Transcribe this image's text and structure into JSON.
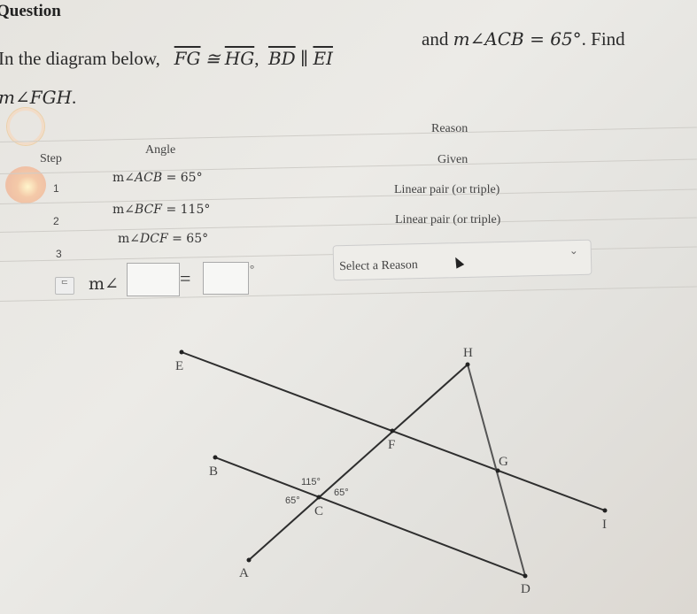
{
  "question_label": "Question",
  "prompt": {
    "intro": "In the diagram below,",
    "seg1": "FG",
    "congruent": "≅",
    "seg2": "HG",
    "comma": ",",
    "seg3": "BD",
    "parallel": "∥",
    "seg4": "EI",
    "and": "and",
    "given_angle": "m∠ACB = 65°",
    "find": ". Find",
    "target": "m∠FGH",
    "period": "."
  },
  "table": {
    "headers": {
      "step": "Step",
      "angle": "Angle",
      "reason": "Reason"
    },
    "rows": [
      {
        "step": "1",
        "angle_m": "m∠",
        "angle_name": "ACB",
        "angle_value": "= 65°",
        "reason": "Given"
      },
      {
        "step": "2",
        "angle_m": "m∠",
        "angle_name": "BCF",
        "angle_value": "= 115°",
        "reason": "Linear pair (or triple)"
      },
      {
        "step": "3",
        "angle_m": "m∠",
        "angle_name": "DCF",
        "angle_value": "= 65°",
        "reason": "Linear pair (or triple)"
      }
    ],
    "active_row": {
      "step_icon": "step-4-icon",
      "step_glyph": "ᄃ",
      "angle_prefix": "m∠",
      "angle_input_value": "",
      "equals": "=",
      "value_input_value": "",
      "degree": "°",
      "reason_select": {
        "selected": "Select a Reason",
        "chevron": "⌄"
      }
    }
  },
  "diagram": {
    "points": {
      "E": "E",
      "F": "F",
      "G": "G",
      "I": "I",
      "B": "B",
      "C": "C",
      "D": "D",
      "A": "A",
      "H": "H"
    },
    "angle_labels": {
      "bcf": "115°",
      "acb": "65°",
      "dcf": "65°"
    }
  }
}
